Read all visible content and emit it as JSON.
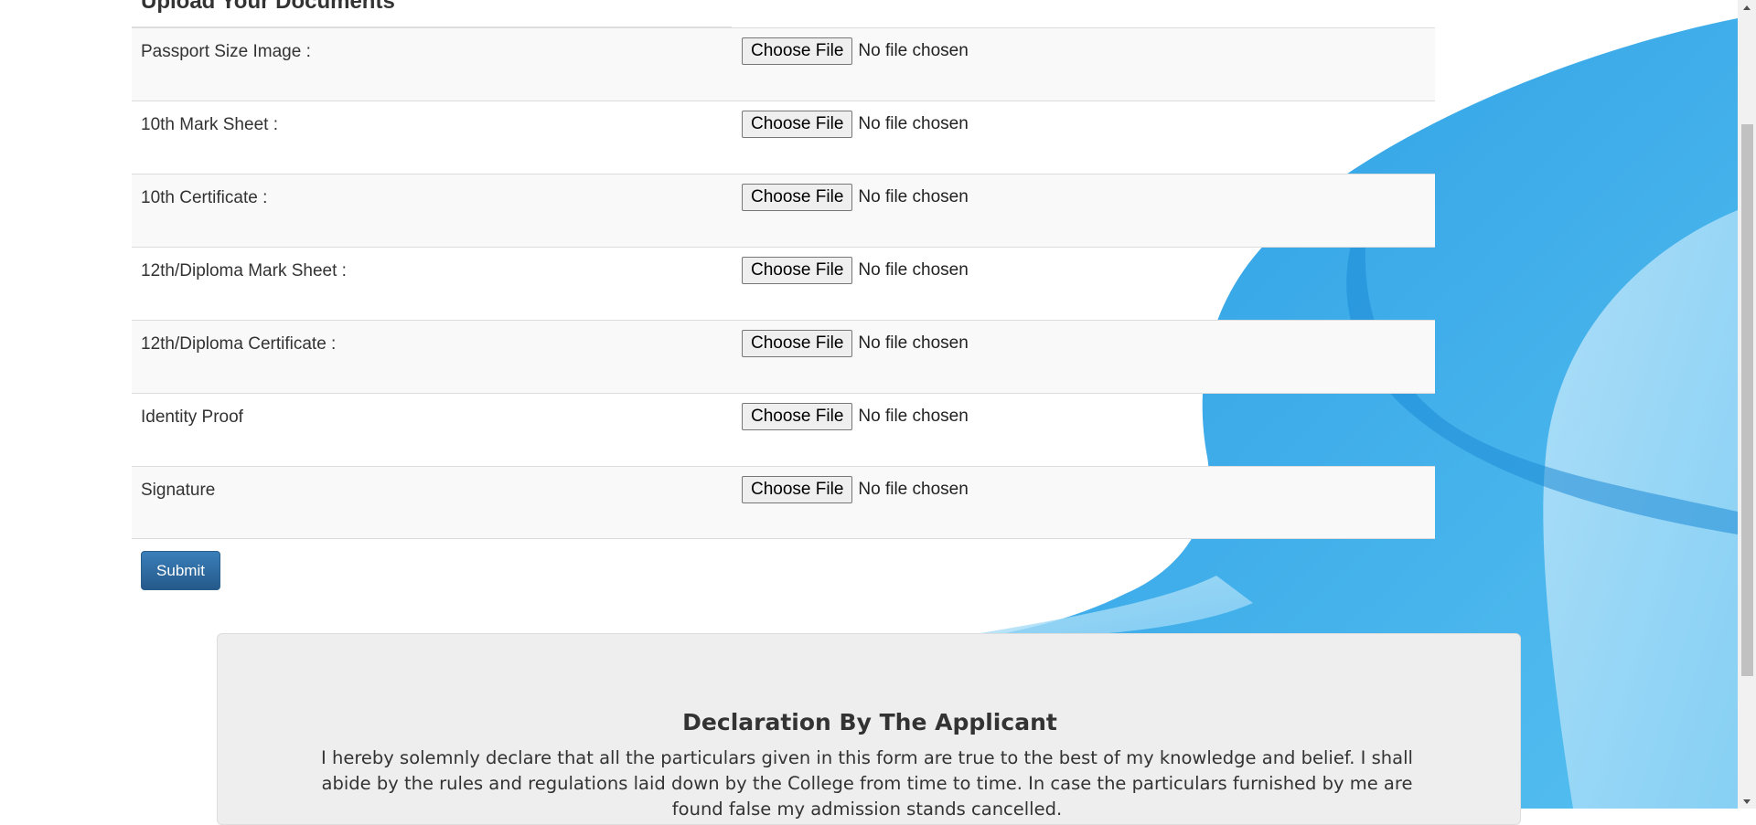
{
  "section": {
    "title": "Upload Your Documents"
  },
  "uploads": [
    {
      "label": "Passport Size Image :",
      "button": "Choose File",
      "status": "No file chosen"
    },
    {
      "label": "10th Mark Sheet :",
      "button": "Choose File",
      "status": "No file chosen"
    },
    {
      "label": "10th Certificate :",
      "button": "Choose File",
      "status": "No file chosen"
    },
    {
      "label": "12th/Diploma Mark Sheet :",
      "button": "Choose File",
      "status": "No file chosen"
    },
    {
      "label": "12th/Diploma Certificate :",
      "button": "Choose File",
      "status": "No file chosen"
    },
    {
      "label": "Identity Proof",
      "button": "Choose File",
      "status": "No file chosen"
    },
    {
      "label": "Signature",
      "button": "Choose File",
      "status": "No file chosen"
    }
  ],
  "form": {
    "submit_label": "Submit"
  },
  "declaration": {
    "title": "Declaration By The Applicant",
    "text": "I hereby solemnly declare that all the particulars given in this form are true to the best of my knowledge and belief. I shall abide by the rules and regulations laid down by the College from time to time. In case the particulars furnished by me are found false my admission stands cancelled."
  },
  "colors": {
    "accent": "#2f6fa8",
    "background_art": "#3aa8e6",
    "row_stripe": "#f9f9f9",
    "declaration_bg": "#eeeeee"
  }
}
